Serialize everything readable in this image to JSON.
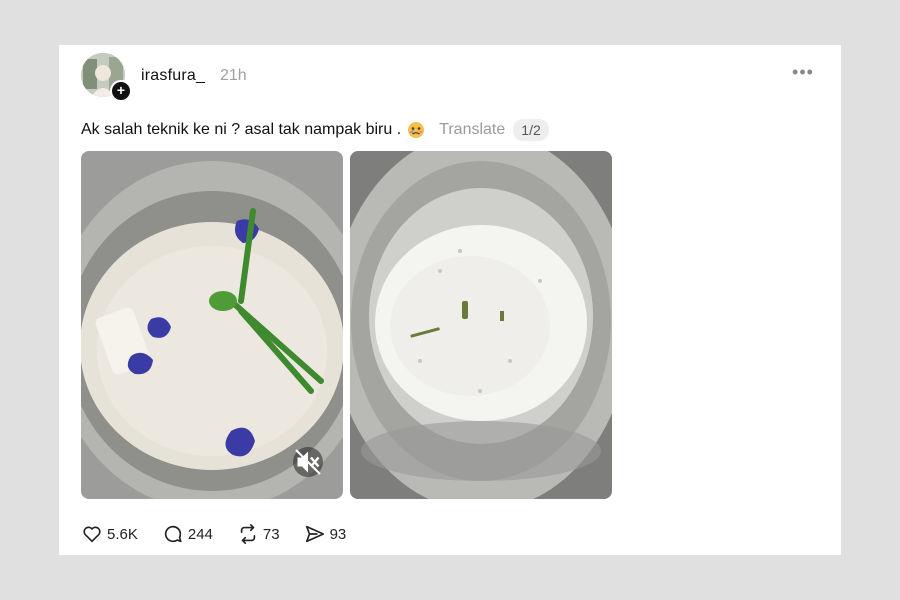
{
  "post": {
    "username": "irasfura_",
    "timestamp": "21h",
    "more_label": "•••",
    "follow_badge": "+",
    "text": "Ak salah teknik ke ni ? asal tak nampak biru .",
    "emoji_icon": "crying-face-emoji",
    "translate_label": "Translate",
    "page_indicator": "1/2"
  },
  "media": [
    {
      "type": "video",
      "description_icon": "rice-with-butterfly-pea-flowers"
    },
    {
      "type": "image",
      "description_icon": "cooked-rice-in-pot"
    }
  ],
  "actions": {
    "likes": "5.6K",
    "comments": "244",
    "reposts": "73",
    "shares": "93"
  },
  "colors": {
    "page_bg": "#e0e0e0",
    "card_bg": "#ffffff",
    "muted_text": "#a0a0a0"
  }
}
